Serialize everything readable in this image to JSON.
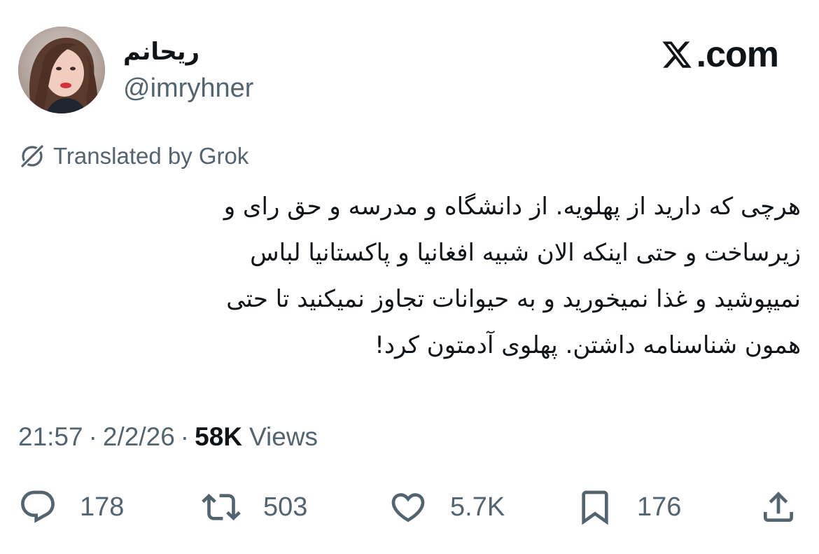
{
  "author": {
    "display_name": "ریحانم",
    "handle": "@imryhner",
    "avatar_icon": "profile-photo"
  },
  "brand": {
    "text": ".com",
    "logo_icon": "x-logo-icon"
  },
  "translation": {
    "label": "Translated by Grok",
    "icon": "grok-icon"
  },
  "tweet": {
    "lines": [
      "هرچی که دارید از پهلویه. از دانشگاه و مدرسه و حق رای و",
      "زیرساخت و حتی اینکه الان شبیه افغانیا و پاکستانیا لباس",
      "نمیپوشید و غذا نمیخورید و به حیوانات تجاوز نمیکنید تا حتی",
      "همون شناسنامه داشتن. پهلوی آدمتون کرد!"
    ]
  },
  "meta": {
    "time": "21:57",
    "separator": "·",
    "date": "2/2/26",
    "views_count": "58K",
    "views_label": "Views"
  },
  "actions": {
    "replies": {
      "icon": "reply-icon",
      "count": "178"
    },
    "reposts": {
      "icon": "repost-icon",
      "count": "503"
    },
    "likes": {
      "icon": "heart-icon",
      "count": "5.7K"
    },
    "bookmarks": {
      "icon": "bookmark-icon",
      "count": "176"
    },
    "share": {
      "icon": "share-icon"
    }
  },
  "colors": {
    "text_primary": "#0f1419",
    "text_secondary": "#536471",
    "background": "#ffffff"
  }
}
